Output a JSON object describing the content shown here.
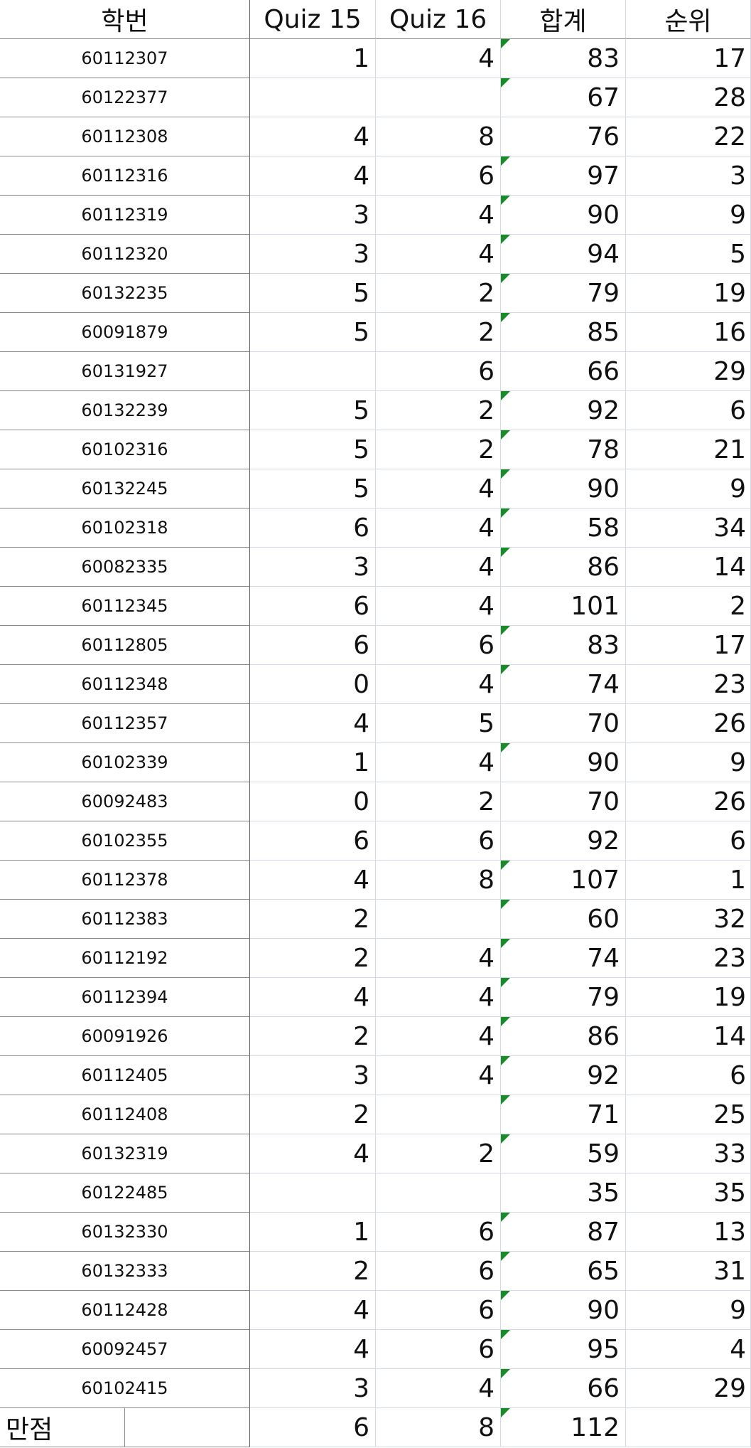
{
  "headers": {
    "id": "학번",
    "q15": "Quiz 15",
    "q16": "Quiz 16",
    "sum": "합계",
    "rank": "순위"
  },
  "rows": [
    {
      "id": "60112307",
      "q15": "1",
      "q16": "4",
      "sum": "83",
      "rank": "17",
      "flag": true
    },
    {
      "id": "60122377",
      "q15": "",
      "q16": "",
      "sum": "67",
      "rank": "28",
      "flag": true
    },
    {
      "id": "60112308",
      "q15": "4",
      "q16": "8",
      "sum": "76",
      "rank": "22",
      "flag": false
    },
    {
      "id": "60112316",
      "q15": "4",
      "q16": "6",
      "sum": "97",
      "rank": "3",
      "flag": true
    },
    {
      "id": "60112319",
      "q15": "3",
      "q16": "4",
      "sum": "90",
      "rank": "9",
      "flag": true
    },
    {
      "id": "60112320",
      "q15": "3",
      "q16": "4",
      "sum": "94",
      "rank": "5",
      "flag": true
    },
    {
      "id": "60132235",
      "q15": "5",
      "q16": "2",
      "sum": "79",
      "rank": "19",
      "flag": true
    },
    {
      "id": "60091879",
      "q15": "5",
      "q16": "2",
      "sum": "85",
      "rank": "16",
      "flag": true
    },
    {
      "id": "60131927",
      "q15": "",
      "q16": "6",
      "sum": "66",
      "rank": "29",
      "flag": false
    },
    {
      "id": "60132239",
      "q15": "5",
      "q16": "2",
      "sum": "92",
      "rank": "6",
      "flag": true
    },
    {
      "id": "60102316",
      "q15": "5",
      "q16": "2",
      "sum": "78",
      "rank": "21",
      "flag": true
    },
    {
      "id": "60132245",
      "q15": "5",
      "q16": "4",
      "sum": "90",
      "rank": "9",
      "flag": true
    },
    {
      "id": "60102318",
      "q15": "6",
      "q16": "4",
      "sum": "58",
      "rank": "34",
      "flag": true
    },
    {
      "id": "60082335",
      "q15": "3",
      "q16": "4",
      "sum": "86",
      "rank": "14",
      "flag": true
    },
    {
      "id": "60112345",
      "q15": "6",
      "q16": "4",
      "sum": "101",
      "rank": "2",
      "flag": false
    },
    {
      "id": "60112805",
      "q15": "6",
      "q16": "6",
      "sum": "83",
      "rank": "17",
      "flag": true
    },
    {
      "id": "60112348",
      "q15": "0",
      "q16": "4",
      "sum": "74",
      "rank": "23",
      "flag": true
    },
    {
      "id": "60112357",
      "q15": "4",
      "q16": "5",
      "sum": "70",
      "rank": "26",
      "flag": false
    },
    {
      "id": "60102339",
      "q15": "1",
      "q16": "4",
      "sum": "90",
      "rank": "9",
      "flag": true
    },
    {
      "id": "60092483",
      "q15": "0",
      "q16": "2",
      "sum": "70",
      "rank": "26",
      "flag": false
    },
    {
      "id": "60102355",
      "q15": "6",
      "q16": "6",
      "sum": "92",
      "rank": "6",
      "flag": false
    },
    {
      "id": "60112378",
      "q15": "4",
      "q16": "8",
      "sum": "107",
      "rank": "1",
      "flag": true
    },
    {
      "id": "60112383",
      "q15": "2",
      "q16": "",
      "sum": "60",
      "rank": "32",
      "flag": true
    },
    {
      "id": "60112192",
      "q15": "2",
      "q16": "4",
      "sum": "74",
      "rank": "23",
      "flag": true
    },
    {
      "id": "60112394",
      "q15": "4",
      "q16": "4",
      "sum": "79",
      "rank": "19",
      "flag": true
    },
    {
      "id": "60091926",
      "q15": "2",
      "q16": "4",
      "sum": "86",
      "rank": "14",
      "flag": true
    },
    {
      "id": "60112405",
      "q15": "3",
      "q16": "4",
      "sum": "92",
      "rank": "6",
      "flag": true
    },
    {
      "id": "60112408",
      "q15": "2",
      "q16": "",
      "sum": "71",
      "rank": "25",
      "flag": true
    },
    {
      "id": "60132319",
      "q15": "4",
      "q16": "2",
      "sum": "59",
      "rank": "33",
      "flag": true
    },
    {
      "id": "60122485",
      "q15": "",
      "q16": "",
      "sum": "35",
      "rank": "35",
      "flag": false
    },
    {
      "id": "60132330",
      "q15": "1",
      "q16": "6",
      "sum": "87",
      "rank": "13",
      "flag": true
    },
    {
      "id": "60132333",
      "q15": "2",
      "q16": "6",
      "sum": "65",
      "rank": "31",
      "flag": true
    },
    {
      "id": "60112428",
      "q15": "4",
      "q16": "6",
      "sum": "90",
      "rank": "9",
      "flag": true
    },
    {
      "id": "60092457",
      "q15": "4",
      "q16": "6",
      "sum": "95",
      "rank": "4",
      "flag": true
    },
    {
      "id": "60102415",
      "q15": "3",
      "q16": "4",
      "sum": "66",
      "rank": "29",
      "flag": true
    }
  ],
  "footer": {
    "label": "만점",
    "q15": "6",
    "q16": "8",
    "sum": "112",
    "flag": true
  },
  "colors": {
    "comment_indicator": "#1a8a2a",
    "gridline": "#d4d8e2"
  }
}
